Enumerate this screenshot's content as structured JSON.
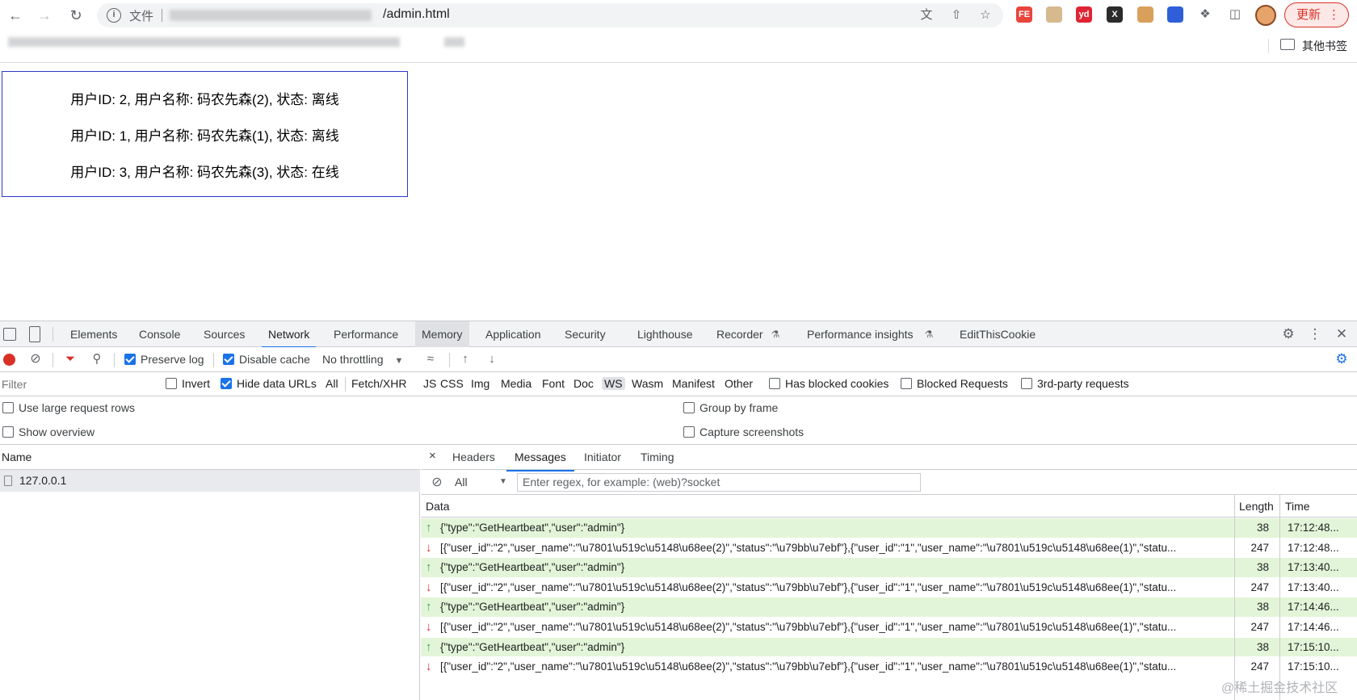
{
  "browser": {
    "file_label": "文件",
    "url_tail": "/admin.html",
    "update_label": "更新",
    "other_bookmarks": "其他书签",
    "extensions": [
      {
        "name": "fe-extension-icon",
        "label": "FE",
        "color": "#e8453c"
      },
      {
        "name": "face-extension-icon",
        "label": "",
        "color": "#d7b98e"
      },
      {
        "name": "youdao-extension-icon",
        "label": "yd",
        "color": "#e02433"
      },
      {
        "name": "x-extension-icon",
        "label": "X",
        "color": "#2b2b2b"
      },
      {
        "name": "cookie-extension-icon",
        "label": "",
        "color": "#d9a05b"
      },
      {
        "name": "orange-blue-extension-icon",
        "label": "",
        "color": "#2f5fd8"
      }
    ]
  },
  "users": [
    "用户ID: 2, 用户名称: 码农先森(2), 状态: 离线",
    "用户ID: 1, 用户名称: 码农先森(1), 状态: 离线",
    "用户ID: 3, 用户名称: 码农先森(3), 状态: 在线"
  ],
  "devtools": {
    "tabs": [
      "Elements",
      "Console",
      "Sources",
      "Network",
      "Performance",
      "Memory",
      "Application",
      "Security",
      "Lighthouse",
      "Recorder",
      "Performance insights",
      "EditThisCookie"
    ],
    "active_tab": "Network",
    "toolbar": {
      "preserve_log": "Preserve log",
      "disable_cache": "Disable cache",
      "throttling": "No throttling"
    },
    "filter": {
      "placeholder": "Filter",
      "invert": "Invert",
      "hide_data_urls": "Hide data URLs",
      "types": [
        "All",
        "Fetch/XHR",
        "JS",
        "CSS",
        "Img",
        "Media",
        "Font",
        "Doc",
        "WS",
        "Wasm",
        "Manifest",
        "Other"
      ],
      "selected_type": "WS",
      "has_blocked_cookies": "Has blocked cookies",
      "blocked_requests": "Blocked Requests",
      "third_party": "3rd-party requests"
    },
    "settings": {
      "large_rows": "Use large request rows",
      "show_overview": "Show overview",
      "group_by_frame": "Group by frame",
      "capture_screenshots": "Capture screenshots"
    },
    "requests": {
      "name_header": "Name",
      "items": [
        "127.0.0.1"
      ]
    },
    "detail": {
      "close": "×",
      "tabs": [
        "Headers",
        "Messages",
        "Initiator",
        "Timing"
      ],
      "active_tab": "Messages",
      "filter_select": "All",
      "regex_placeholder": "Enter regex, for example: (web)?socket",
      "columns": {
        "data": "Data",
        "length": "Length",
        "time": "Time"
      },
      "messages": [
        {
          "dir": "sent",
          "data": "{\"type\":\"GetHeartbeat\",\"user\":\"admin\"}",
          "length": "38",
          "time": "17:12:48..."
        },
        {
          "dir": "recv",
          "data": "[{\"user_id\":\"2\",\"user_name\":\"\\u7801\\u519c\\u5148\\u68ee(2)\",\"status\":\"\\u79bb\\u7ebf\"},{\"user_id\":\"1\",\"user_name\":\"\\u7801\\u519c\\u5148\\u68ee(1)\",\"statu...",
          "length": "247",
          "time": "17:12:48..."
        },
        {
          "dir": "sent",
          "data": "{\"type\":\"GetHeartbeat\",\"user\":\"admin\"}",
          "length": "38",
          "time": "17:13:40..."
        },
        {
          "dir": "recv",
          "data": "[{\"user_id\":\"2\",\"user_name\":\"\\u7801\\u519c\\u5148\\u68ee(2)\",\"status\":\"\\u79bb\\u7ebf\"},{\"user_id\":\"1\",\"user_name\":\"\\u7801\\u519c\\u5148\\u68ee(1)\",\"statu...",
          "length": "247",
          "time": "17:13:40..."
        },
        {
          "dir": "sent",
          "data": "{\"type\":\"GetHeartbeat\",\"user\":\"admin\"}",
          "length": "38",
          "time": "17:14:46..."
        },
        {
          "dir": "recv",
          "data": "[{\"user_id\":\"2\",\"user_name\":\"\\u7801\\u519c\\u5148\\u68ee(2)\",\"status\":\"\\u79bb\\u7ebf\"},{\"user_id\":\"1\",\"user_name\":\"\\u7801\\u519c\\u5148\\u68ee(1)\",\"statu...",
          "length": "247",
          "time": "17:14:46..."
        },
        {
          "dir": "sent",
          "data": "{\"type\":\"GetHeartbeat\",\"user\":\"admin\"}",
          "length": "38",
          "time": "17:15:10..."
        },
        {
          "dir": "recv",
          "data": "[{\"user_id\":\"2\",\"user_name\":\"\\u7801\\u519c\\u5148\\u68ee(2)\",\"status\":\"\\u79bb\\u7ebf\"},{\"user_id\":\"1\",\"user_name\":\"\\u7801\\u519c\\u5148\\u68ee(1)\",\"statu...",
          "length": "247",
          "time": "17:15:10..."
        }
      ]
    }
  },
  "watermark": "@稀土掘金技术社区"
}
